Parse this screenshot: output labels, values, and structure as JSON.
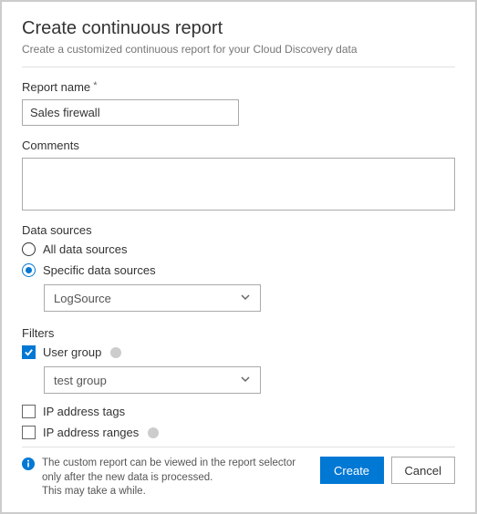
{
  "header": {
    "title": "Create continuous report",
    "subtitle": "Create a customized continuous report for your Cloud Discovery data"
  },
  "fields": {
    "reportName": {
      "label": "Report name",
      "value": "Sales firewall"
    },
    "comments": {
      "label": "Comments",
      "value": ""
    }
  },
  "dataSources": {
    "label": "Data sources",
    "options": {
      "all": "All data sources",
      "specific": "Specific data sources"
    },
    "selected": "specific",
    "select": {
      "value": "LogSource"
    }
  },
  "filters": {
    "label": "Filters",
    "userGroup": {
      "label": "User group",
      "checked": true,
      "select": {
        "value": "test group"
      }
    },
    "ipTags": {
      "label": "IP address tags",
      "checked": false
    },
    "ipRanges": {
      "label": "IP address ranges",
      "checked": false
    }
  },
  "footer": {
    "info": "The custom report can be viewed in the report selector only after the new data is processed.\nThis may take a while.",
    "create": "Create",
    "cancel": "Cancel"
  }
}
